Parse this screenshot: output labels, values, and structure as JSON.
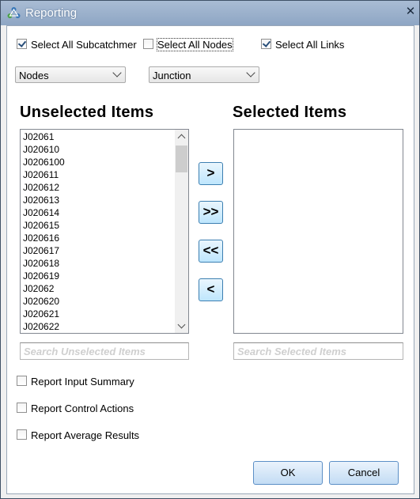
{
  "window": {
    "title": "Reporting",
    "close_label": "✕"
  },
  "checkboxes": {
    "select_all_subcatchments": {
      "label": "Select All Subcatchmer",
      "checked": true
    },
    "select_all_nodes": {
      "label": "Select All Nodes",
      "checked": false
    },
    "select_all_links": {
      "label": "Select All Links",
      "checked": true
    }
  },
  "dropdowns": {
    "object_type": {
      "value": "Nodes"
    },
    "object_subtype": {
      "value": "Junction"
    }
  },
  "unselected": {
    "heading": "Unselected Items",
    "items": [
      "J02061",
      "J020610",
      "J0206100",
      "J020611",
      "J020612",
      "J020613",
      "J020614",
      "J020615",
      "J020616",
      "J020617",
      "J020618",
      "J020619",
      "J02062",
      "J020620",
      "J020621",
      "J020622"
    ],
    "search_placeholder": "Search Unselected Items"
  },
  "selected": {
    "heading": "Selected Items",
    "items": [],
    "search_placeholder": "Search Selected Items"
  },
  "move_buttons": {
    "add_one": ">",
    "add_all": ">>",
    "remove_all": "<<",
    "remove_one": "<"
  },
  "options": {
    "report_input_summary": {
      "label": "Report Input Summary",
      "checked": false
    },
    "report_control_actions": {
      "label": "Report Control Actions",
      "checked": false
    },
    "report_average_results": {
      "label": "Report Average Results",
      "checked": false
    }
  },
  "buttons": {
    "ok": "OK",
    "cancel": "Cancel"
  }
}
